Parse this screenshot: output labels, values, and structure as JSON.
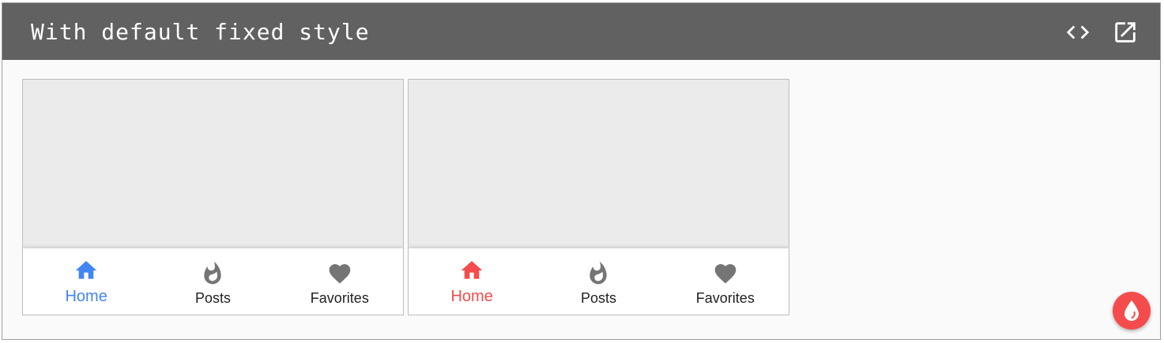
{
  "header": {
    "title": "With default fixed style",
    "code_icon": "code-icon",
    "open_icon": "open-in-new-icon"
  },
  "demos": [
    {
      "items": [
        {
          "label": "Home",
          "icon": "home-icon",
          "active": true
        },
        {
          "label": "Posts",
          "icon": "fire-icon",
          "active": false
        },
        {
          "label": "Favorites",
          "icon": "heart-icon",
          "active": false
        }
      ],
      "accent": "#4285f4"
    },
    {
      "items": [
        {
          "label": "Home",
          "icon": "home-icon",
          "active": true
        },
        {
          "label": "Posts",
          "icon": "fire-icon",
          "active": false
        },
        {
          "label": "Favorites",
          "icon": "heart-icon",
          "active": false
        }
      ],
      "accent": "#f44c4c"
    }
  ],
  "fab": {
    "icon": "droplet-icon",
    "color": "#f44c4c"
  },
  "colors": {
    "header_bg": "#616161",
    "inactive_icon": "#757575"
  }
}
